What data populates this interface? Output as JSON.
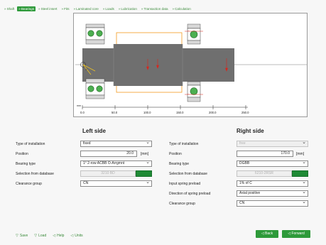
{
  "tabs": [
    {
      "label": "Shaft",
      "active": false
    },
    {
      "label": "Bearings",
      "active": true
    },
    {
      "label": "Steel insert",
      "active": false
    },
    {
      "label": "Fits",
      "active": false
    },
    {
      "label": "Laminated core",
      "active": false
    },
    {
      "label": "Loads",
      "active": false
    },
    {
      "label": "Lubrication",
      "active": false
    },
    {
      "label": "Transaction data",
      "active": false
    },
    {
      "label": "Calculation",
      "active": false
    }
  ],
  "drawing": {
    "axis_unit": "mm",
    "ticks": [
      "0.0",
      "50.0",
      "100.0",
      "150.0",
      "200.0",
      "250.0"
    ]
  },
  "left": {
    "title": "Left side",
    "labels": {
      "installation": "Type of installation",
      "position": "Position",
      "bearing_type": "Bearing type",
      "database": "Selection from database",
      "clearance": "Clearance group"
    },
    "installation_value": "fixed",
    "position_value": "20.0",
    "position_unit": "[mm]",
    "bearing_type_value": "1° 2-row ACBB O-Arrgmnt",
    "database_value": "3210 BD",
    "clearance_value": "CN"
  },
  "right": {
    "title": "Right side",
    "labels": {
      "installation": "Type of installation",
      "position": "Position",
      "bearing_type": "Bearing type",
      "database": "Selection from database",
      "spring_preload": "Input spring preload",
      "spring_direction": "Direction of spring preload",
      "clearance": "Clearance group"
    },
    "installation_value": "free",
    "position_value": "170.0",
    "position_unit": "[mm]",
    "bearing_type_value": "DGBB",
    "database_value": "6210-2RSR",
    "spring_preload_value": "1% of C",
    "spring_direction_value": "Axial positive",
    "clearance_value": "CN"
  },
  "footer": {
    "save": "Save",
    "load": "Load",
    "help": "Help",
    "units": "Units",
    "back": "Back",
    "forward": "Forward"
  },
  "colors": {
    "accent_green": "#2e9a3a",
    "shaft_gray": "#6f6f6f",
    "ring_green": "#4caf50",
    "load_orange": "#f29a1f",
    "force_red": "#d9261c"
  }
}
